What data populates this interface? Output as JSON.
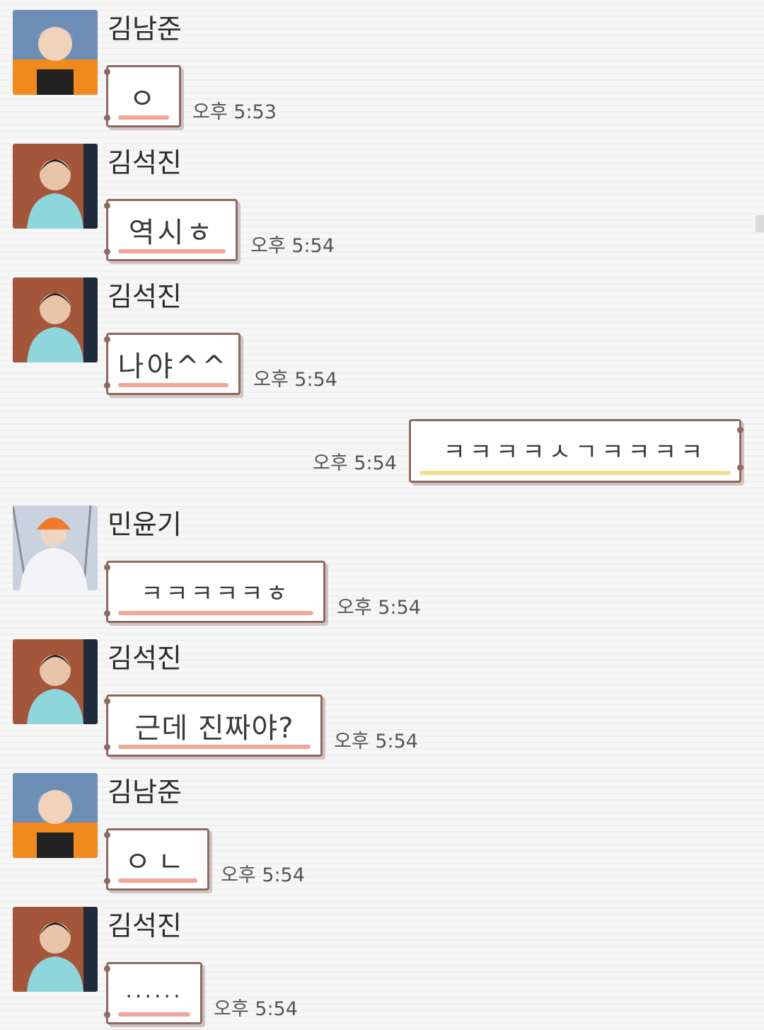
{
  "messages": [
    {
      "sender": "김남준",
      "text": "ㅇ",
      "time": "오후 5:53",
      "avatar": "namjoon"
    },
    {
      "sender": "김석진",
      "text": "역시ㅎ",
      "time": "오후 5:54",
      "avatar": "seokjin"
    },
    {
      "sender": "김석진",
      "text": "나야^^",
      "time": "오후 5:54",
      "avatar": "seokjin"
    },
    {
      "sender": "민윤기",
      "text": "ㅋㅋㅋㅋㅋㅎ",
      "time": "오후 5:54",
      "avatar": "yoongi"
    },
    {
      "sender": "김석진",
      "text": "근데 진짜야?",
      "time": "오후 5:54",
      "avatar": "seokjin"
    },
    {
      "sender": "김남준",
      "text": "ㅇㄴ",
      "time": "오후 5:54",
      "avatar": "namjoon"
    },
    {
      "sender": "김석진",
      "text": "......",
      "time": "오후 5:54",
      "avatar": "seokjin"
    }
  ],
  "own_message": {
    "text": "ㅋㅋㅋㅋㅅㄱㅋㅋㅋㅋ",
    "time": "오후 5:54"
  },
  "colors": {
    "bubble_border": "#8c6a5f",
    "received_underline": "#f2a69b",
    "sent_underline": "#f5dc8a"
  }
}
